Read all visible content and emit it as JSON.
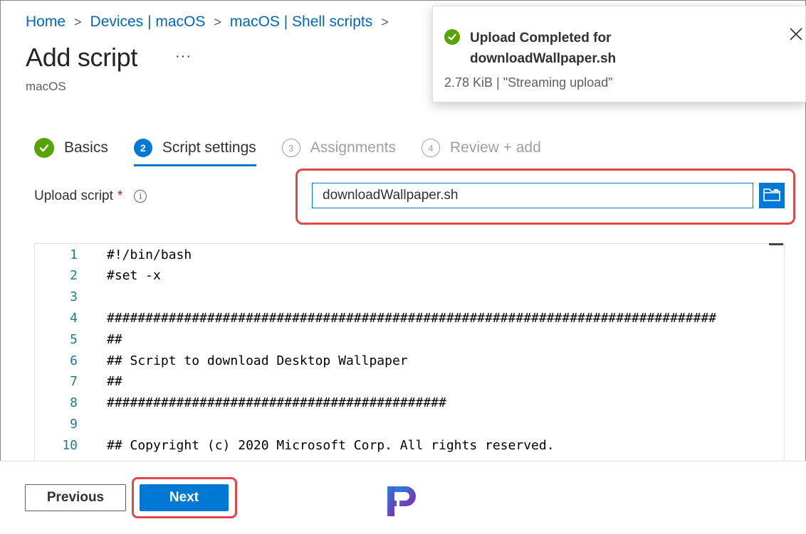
{
  "breadcrumb": {
    "items": [
      "Home",
      "Devices | macOS",
      "macOS | Shell scripts"
    ],
    "separator": ">"
  },
  "page": {
    "title": "Add script",
    "more": "···",
    "subtitle": "macOS"
  },
  "tabs": [
    {
      "label": "Basics",
      "state": "done",
      "marker": "✓"
    },
    {
      "label": "Script settings",
      "state": "active",
      "marker": "2"
    },
    {
      "label": "Assignments",
      "state": "pending",
      "marker": "3"
    },
    {
      "label": "Review + add",
      "state": "pending",
      "marker": "4"
    }
  ],
  "upload": {
    "label": "Upload script",
    "required_marker": "*",
    "info_icon": "i",
    "value": "downloadWallpaper.sh",
    "browse_icon": "folder-icon"
  },
  "code": {
    "lines": [
      {
        "n": "1",
        "text": "#!/bin/bash"
      },
      {
        "n": "2",
        "text": "#set -x"
      },
      {
        "n": "3",
        "text": ""
      },
      {
        "n": "4",
        "text": "###############################################################################"
      },
      {
        "n": "5",
        "text": "##"
      },
      {
        "n": "6",
        "text": "## Script to download Desktop Wallpaper"
      },
      {
        "n": "7",
        "text": "##"
      },
      {
        "n": "8",
        "text": "############################################"
      },
      {
        "n": "9",
        "text": ""
      },
      {
        "n": "10",
        "text": "## Copyright (c) 2020 Microsoft Corp. All rights reserved."
      }
    ]
  },
  "footer": {
    "previous_label": "Previous",
    "next_label": "Next",
    "logo_letter": "P"
  },
  "toast": {
    "title": "Upload Completed for downloadWallpaper.sh",
    "meta": "2.78 KiB | \"Streaming upload\"",
    "close_icon": "close-icon",
    "status_icon": "check-circle-icon"
  },
  "colors": {
    "accent": "#0078d4",
    "success": "#57a300",
    "highlight": "#e0474c",
    "link": "#0067b8"
  }
}
